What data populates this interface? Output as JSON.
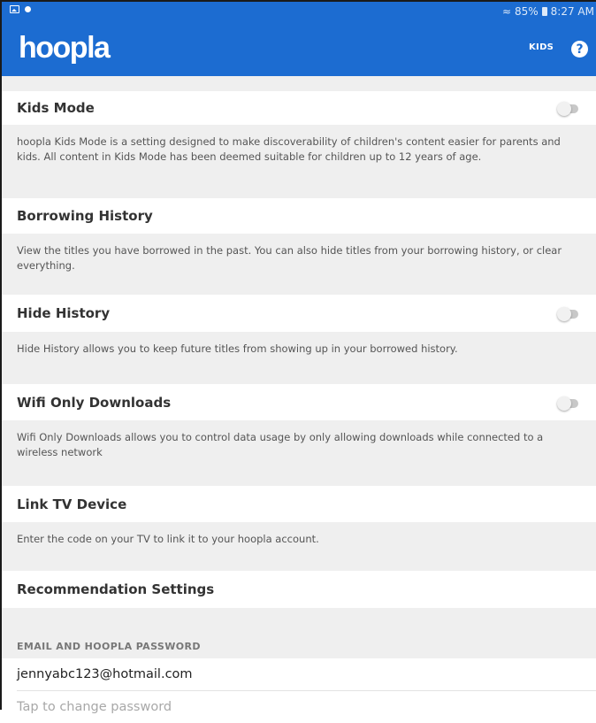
{
  "status_bar": {
    "battery": "85%",
    "time": "8:27 AM"
  },
  "header": {
    "logo": "hoopla",
    "kids_label": "KIDS",
    "help_label": "?"
  },
  "settings": [
    {
      "title": "Kids Mode",
      "toggle": true,
      "toggle_on": false,
      "description": "hoopla Kids Mode is a setting designed to make discoverability of children's content easier for parents and kids. All content in Kids Mode has been deemed suitable for children up to 12 years of age."
    },
    {
      "title": "Borrowing History",
      "toggle": false,
      "description": "View the titles you have borrowed in the past. You can also hide titles from your borrowing history, or clear everything."
    },
    {
      "title": "Hide History",
      "toggle": true,
      "toggle_on": false,
      "description": "Hide History allows you to keep future titles from showing up in your borrowed history."
    },
    {
      "title": "Wifi Only Downloads",
      "toggle": true,
      "toggle_on": false,
      "description": "Wifi Only Downloads allows you to control data usage by only allowing downloads while connected to a wireless network"
    },
    {
      "title": "Link TV Device",
      "toggle": false,
      "description": "Enter the code on your TV to link it to your hoopla account."
    },
    {
      "title": "Recommendation Settings",
      "toggle": false,
      "description": ""
    }
  ],
  "account": {
    "section_header": "EMAIL AND HOOPLA PASSWORD",
    "email": "jennyabc123@hotmail.com",
    "password_prompt": "Tap to change password"
  }
}
